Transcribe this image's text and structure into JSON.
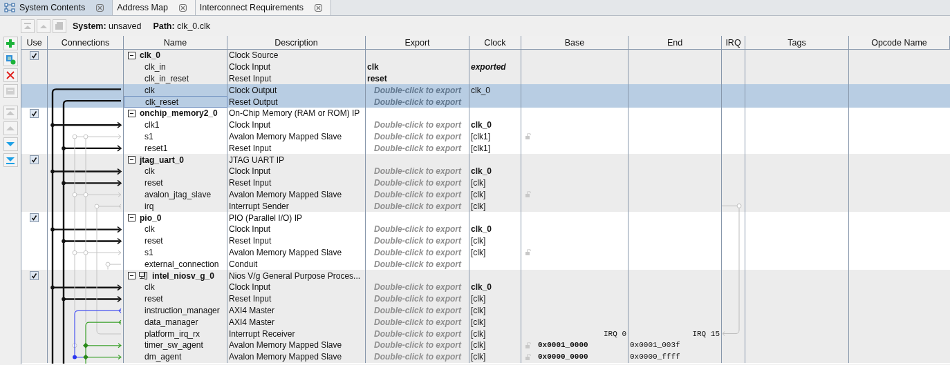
{
  "tabs": [
    {
      "label": "System Contents",
      "selected": true,
      "kind": "system"
    },
    {
      "label": "Address Map",
      "selected": false,
      "kind": "plain"
    },
    {
      "label": "Interconnect Requirements",
      "selected": false,
      "kind": "plain"
    }
  ],
  "toolbar": [
    {
      "kind": "move-top",
      "disabled": true
    },
    {
      "kind": "move-up",
      "disabled": true
    },
    {
      "kind": "component",
      "disabled": true
    }
  ],
  "path_bar": {
    "system_label": "System:",
    "system_value": "unsaved",
    "path_label": "Path:",
    "path_value": "clk_0.clk"
  },
  "side_toolbar": [
    {
      "kind": "add",
      "disabled": false
    },
    {
      "kind": "add-component",
      "disabled": false
    },
    {
      "kind": "remove",
      "disabled": false
    },
    {
      "kind": "edit",
      "disabled": true
    },
    {
      "kind": "move-top",
      "disabled": true
    },
    {
      "kind": "move-up",
      "disabled": true
    },
    {
      "kind": "move-down",
      "disabled": false
    },
    {
      "kind": "move-bottom",
      "disabled": false
    }
  ],
  "table": {
    "columns": [
      "Use",
      "Connections",
      "Name",
      "Description",
      "Export",
      "Clock",
      "Base",
      "End",
      "IRQ",
      "Tags",
      "Opcode Name"
    ]
  },
  "components": [
    {
      "name": "clk_0",
      "description": "Clock Source",
      "use": true,
      "expanded": true,
      "kind": "plain",
      "ports": [
        {
          "name": "clk_in",
          "description": "Clock Input",
          "export": {
            "text": "clk",
            "kind": "exported"
          },
          "clock": {
            "text": "exported",
            "kind": "exported"
          },
          "locked": false,
          "selected": false,
          "focused": false
        },
        {
          "name": "clk_in_reset",
          "description": "Reset Input",
          "export": {
            "text": "reset",
            "kind": "exported"
          },
          "locked": false,
          "selected": false,
          "focused": false
        },
        {
          "name": "clk",
          "description": "Clock Output",
          "export": {
            "text": "Double-click to export",
            "kind": "hint"
          },
          "clock": {
            "text": "clk_0",
            "kind": "plain"
          },
          "locked": false,
          "selected": true,
          "focused": false
        },
        {
          "name": "clk_reset",
          "description": "Reset Output",
          "export": {
            "text": "Double-click to export",
            "kind": "hint"
          },
          "locked": false,
          "selected": true,
          "focused": true
        }
      ]
    },
    {
      "name": "onchip_memory2_0",
      "description": "On-Chip Memory (RAM or ROM) IP",
      "use": true,
      "expanded": true,
      "kind": "plain",
      "ports": [
        {
          "name": "clk1",
          "description": "Clock Input",
          "export": {
            "text": "Double-click to export",
            "kind": "hint"
          },
          "clock": {
            "text": "clk_0",
            "kind": "bold"
          },
          "locked": false,
          "selected": false,
          "focused": false
        },
        {
          "name": "s1",
          "description": "Avalon Memory Mapped Slave",
          "export": {
            "text": "Double-click to export",
            "kind": "hint"
          },
          "clock": {
            "text": "[clk1]",
            "kind": "plain"
          },
          "locked": true,
          "selected": false,
          "focused": false
        },
        {
          "name": "reset1",
          "description": "Reset Input",
          "export": {
            "text": "Double-click to export",
            "kind": "hint"
          },
          "clock": {
            "text": "[clk1]",
            "kind": "plain"
          },
          "locked": false,
          "selected": false,
          "focused": false
        }
      ]
    },
    {
      "name": "jtag_uart_0",
      "description": "JTAG UART IP",
      "use": true,
      "expanded": true,
      "kind": "plain",
      "ports": [
        {
          "name": "clk",
          "description": "Clock Input",
          "export": {
            "text": "Double-click to export",
            "kind": "hint"
          },
          "clock": {
            "text": "clk_0",
            "kind": "bold"
          },
          "locked": false,
          "selected": false,
          "focused": false
        },
        {
          "name": "reset",
          "description": "Reset Input",
          "export": {
            "text": "Double-click to export",
            "kind": "hint"
          },
          "clock": {
            "text": "[clk]",
            "kind": "plain"
          },
          "locked": false,
          "selected": false,
          "focused": false
        },
        {
          "name": "avalon_jtag_slave",
          "description": "Avalon Memory Mapped Slave",
          "export": {
            "text": "Double-click to export",
            "kind": "hint"
          },
          "clock": {
            "text": "[clk]",
            "kind": "plain"
          },
          "locked": true,
          "selected": false,
          "focused": false
        },
        {
          "name": "irq",
          "description": "Interrupt Sender",
          "export": {
            "text": "Double-click to export",
            "kind": "hint"
          },
          "clock": {
            "text": "[clk]",
            "kind": "plain"
          },
          "locked": false,
          "selected": false,
          "focused": false
        }
      ]
    },
    {
      "name": "pio_0",
      "description": "PIO (Parallel I/O) IP",
      "use": true,
      "expanded": true,
      "kind": "plain",
      "ports": [
        {
          "name": "clk",
          "description": "Clock Input",
          "export": {
            "text": "Double-click to export",
            "kind": "hint"
          },
          "clock": {
            "text": "clk_0",
            "kind": "bold"
          },
          "locked": false,
          "selected": false,
          "focused": false
        },
        {
          "name": "reset",
          "description": "Reset Input",
          "export": {
            "text": "Double-click to export",
            "kind": "hint"
          },
          "clock": {
            "text": "[clk]",
            "kind": "plain"
          },
          "locked": false,
          "selected": false,
          "focused": false
        },
        {
          "name": "s1",
          "description": "Avalon Memory Mapped Slave",
          "export": {
            "text": "Double-click to export",
            "kind": "hint"
          },
          "clock": {
            "text": "[clk]",
            "kind": "plain"
          },
          "locked": true,
          "selected": false,
          "focused": false
        },
        {
          "name": "external_connection",
          "description": "Conduit",
          "export": {
            "text": "Double-click to export",
            "kind": "hint"
          },
          "locked": false,
          "selected": false,
          "focused": false
        }
      ]
    },
    {
      "name": "intel_niosv_g_0",
      "description": "Nios V/g General Purpose Proces...",
      "use": true,
      "expanded": true,
      "kind": "processor",
      "ports": [
        {
          "name": "clk",
          "description": "Clock Input",
          "export": {
            "text": "Double-click to export",
            "kind": "hint"
          },
          "clock": {
            "text": "clk_0",
            "kind": "bold"
          },
          "locked": false,
          "selected": false,
          "focused": false
        },
        {
          "name": "reset",
          "description": "Reset Input",
          "export": {
            "text": "Double-click to export",
            "kind": "hint"
          },
          "clock": {
            "text": "[clk]",
            "kind": "plain"
          },
          "locked": false,
          "selected": false,
          "focused": false
        },
        {
          "name": "instruction_manager",
          "description": "AXI4 Master",
          "export": {
            "text": "Double-click to export",
            "kind": "hint"
          },
          "clock": {
            "text": "[clk]",
            "kind": "plain"
          },
          "locked": false,
          "selected": false,
          "focused": false
        },
        {
          "name": "data_manager",
          "description": "AXI4 Master",
          "export": {
            "text": "Double-click to export",
            "kind": "hint"
          },
          "clock": {
            "text": "[clk]",
            "kind": "plain"
          },
          "locked": false,
          "selected": false,
          "focused": false
        },
        {
          "name": "platform_irq_rx",
          "description": "Interrupt Receiver",
          "export": {
            "text": "Double-click to export",
            "kind": "hint"
          },
          "clock": {
            "text": "[clk]",
            "kind": "plain"
          },
          "base": {
            "text": "IRQ 0",
            "kind": "irq"
          },
          "end": {
            "text": "IRQ 15",
            "kind": "irq"
          },
          "locked": false,
          "selected": false,
          "focused": false
        },
        {
          "name": "timer_sw_agent",
          "description": "Avalon Memory Mapped Slave",
          "export": {
            "text": "Double-click to export",
            "kind": "hint"
          },
          "clock": {
            "text": "[clk]",
            "kind": "plain"
          },
          "base": {
            "text": "0x0001_0000",
            "kind": "address"
          },
          "end": {
            "text": "0x0001_003f",
            "kind": "address"
          },
          "locked": true,
          "selected": false,
          "focused": false
        },
        {
          "name": "dm_agent",
          "description": "Avalon Memory Mapped Slave",
          "export": {
            "text": "Double-click to export",
            "kind": "hint"
          },
          "clock": {
            "text": "[clk]",
            "kind": "plain"
          },
          "base": {
            "text": "0x0000_0000",
            "kind": "address"
          },
          "end": {
            "text": "0x0000_ffff",
            "kind": "address"
          },
          "locked": true,
          "selected": false,
          "focused": false
        }
      ]
    }
  ]
}
